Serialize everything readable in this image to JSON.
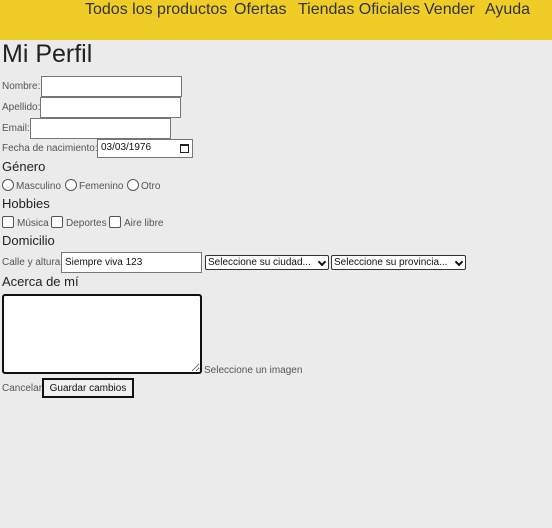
{
  "nav": {
    "items": [
      {
        "label": "Todos los productos"
      },
      {
        "label": "Ofertas"
      },
      {
        "label": "Tiendas Oficiales"
      },
      {
        "label": "Vender"
      },
      {
        "label": "Ayuda"
      }
    ]
  },
  "page": {
    "title": "Mi Perfil"
  },
  "form": {
    "nombre_label": "Nombre:",
    "nombre_value": "",
    "apellido_label": "Apellido:",
    "apellido_value": "",
    "email_label": "Email:",
    "email_value": "",
    "fecha_label": "Fecha de nacimiento:",
    "fecha_value": "03/03/1976",
    "genero_heading": "Género",
    "genero_options": [
      "Masculino",
      "Femenino",
      "Otro"
    ],
    "hobbies_heading": "Hobbies",
    "hobbies_options": [
      "Música",
      "Deportes",
      "Aire libre"
    ],
    "domicilio_heading": "Domicilio",
    "calle_label": "Calle y altura:",
    "calle_value": "Siempre viva 123",
    "ciudad_select": "Seleccione su ciudad...",
    "provincia_select": "Seleccione su provincia...",
    "acerca_heading": "Acerca de mí",
    "acerca_value": "",
    "imagen_label": "Seleccione un imagen",
    "cancel_label": "Cancelar",
    "save_label": "Guardar cambios"
  }
}
